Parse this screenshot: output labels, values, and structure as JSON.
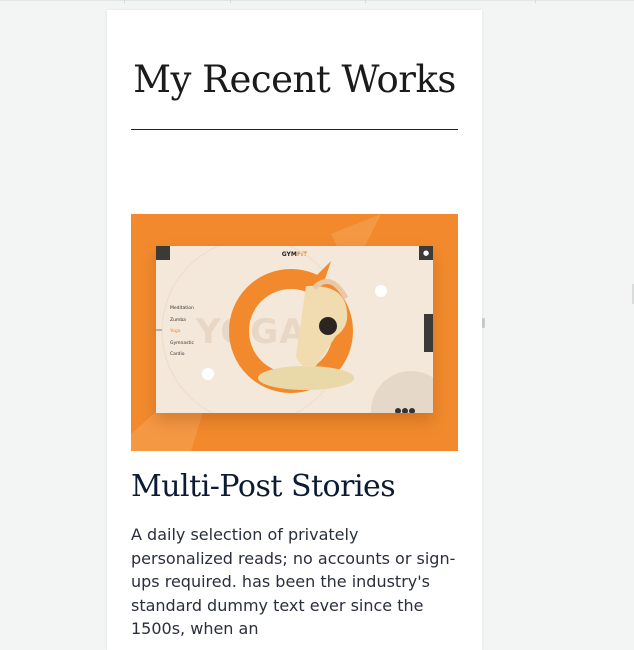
{
  "section": {
    "title": "My Recent Works"
  },
  "work": {
    "title": "Multi-Post Stories",
    "description": "A daily selection of privately personalized reads; no accounts or sign-ups required. has been the industry's standard dummy text ever since the 1500s, when an",
    "image": {
      "app_logo_prefix": "GYM",
      "app_logo_suffix": "FIT",
      "watermark": "YOGA",
      "menu_items": [
        "Meditation",
        "Zumba",
        "Yoga",
        "Gymnastic",
        "Cardio"
      ],
      "active_menu_item": "Yoga",
      "accent_color": "#f28a2d"
    }
  },
  "colors": {
    "page_bg": "#f3f5f4",
    "card_bg": "#ffffff",
    "heading": "#0c1b33",
    "thumb_bg": "#f28a2d"
  }
}
